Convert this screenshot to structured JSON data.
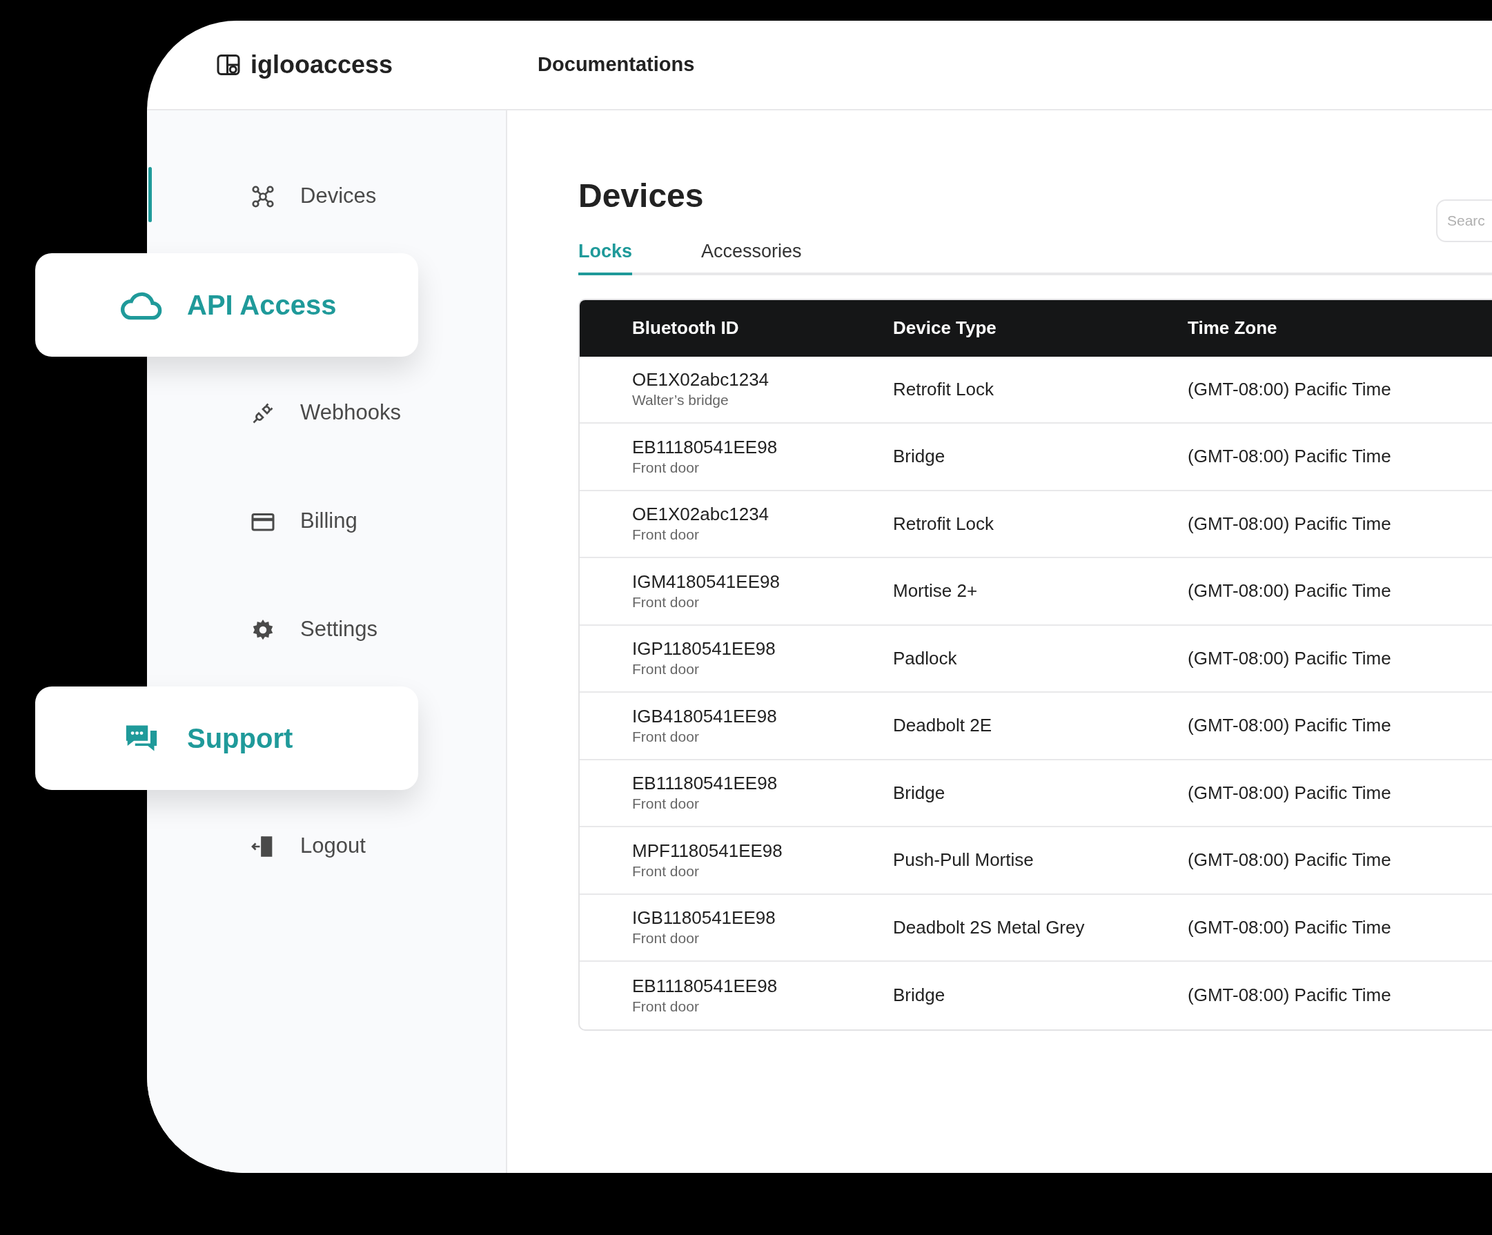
{
  "header": {
    "logo": "iglooaccess",
    "nav_link": "Documentations"
  },
  "sidebar": {
    "items": [
      {
        "label": "Devices",
        "selected": true,
        "highlighted": false
      },
      {
        "label": "API Access",
        "selected": false,
        "highlighted": true
      },
      {
        "label": "Webhooks",
        "selected": false,
        "highlighted": false
      },
      {
        "label": "Billing",
        "selected": false,
        "highlighted": false
      },
      {
        "label": "Settings",
        "selected": false,
        "highlighted": false
      },
      {
        "label": "Support",
        "selected": false,
        "highlighted": true
      },
      {
        "label": "Logout",
        "selected": false,
        "highlighted": false
      }
    ]
  },
  "page": {
    "title": "Devices",
    "search": {
      "placeholder": "Searc"
    },
    "tabs": [
      {
        "label": "Locks",
        "selected": true
      },
      {
        "label": "Accessories",
        "selected": false
      }
    ],
    "table": {
      "columns": [
        "Bluetooth ID",
        "Device Type",
        "Time Zone"
      ],
      "rows": [
        {
          "id": "OE1X02abc1234",
          "location": "Walter’s bridge",
          "type": "Retrofit Lock",
          "tz": "(GMT-08:00) Pacific Time"
        },
        {
          "id": "EB11180541EE98",
          "location": "Front door",
          "type": "Bridge",
          "tz": "(GMT-08:00) Pacific Time"
        },
        {
          "id": "OE1X02abc1234",
          "location": "Front door",
          "type": "Retrofit Lock",
          "tz": "(GMT-08:00) Pacific Time"
        },
        {
          "id": "IGM4180541EE98",
          "location": "Front door",
          "type": "Mortise 2+",
          "tz": "(GMT-08:00) Pacific Time"
        },
        {
          "id": "IGP1180541EE98",
          "location": "Front door",
          "type": "Padlock",
          "tz": "(GMT-08:00) Pacific Time"
        },
        {
          "id": "IGB4180541EE98",
          "location": "Front door",
          "type": "Deadbolt 2E",
          "tz": "(GMT-08:00) Pacific Time"
        },
        {
          "id": "EB11180541EE98",
          "location": "Front door",
          "type": "Bridge",
          "tz": "(GMT-08:00) Pacific Time"
        },
        {
          "id": "MPF1180541EE98",
          "location": "Front door",
          "type": "Push-Pull Mortise",
          "tz": "(GMT-08:00) Pacific Time"
        },
        {
          "id": "IGB1180541EE98",
          "location": "Front door",
          "type": "Deadbolt 2S Metal Grey",
          "tz": "(GMT-08:00) Pacific Time"
        },
        {
          "id": "EB11180541EE98",
          "location": "Front door",
          "type": "Bridge",
          "tz": "(GMT-08:00) Pacific Time"
        }
      ]
    }
  }
}
